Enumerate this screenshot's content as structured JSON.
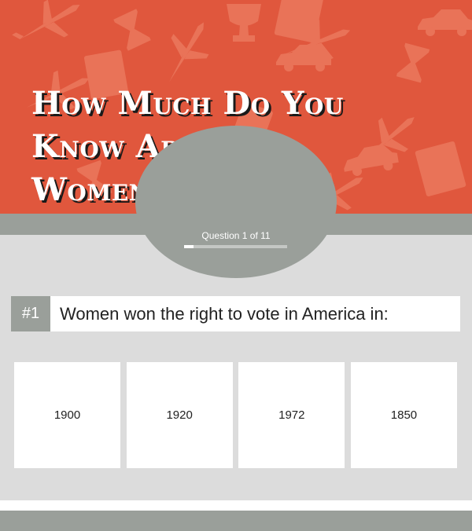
{
  "header": {
    "title_lines": [
      "How Much Do You",
      "Know About",
      "Women's History?"
    ],
    "background_color": "#e0573d",
    "pattern_icons": [
      "airplane-icon",
      "hourglass-icon",
      "book-icon",
      "trophy-icon",
      "car-icon"
    ]
  },
  "progress": {
    "label": "Question 1 of 11",
    "current": 1,
    "total": 11
  },
  "question": {
    "number": "#1",
    "text": "Women won the right to vote in America in:"
  },
  "answers": [
    {
      "label": "1900"
    },
    {
      "label": "1920"
    },
    {
      "label": "1972"
    },
    {
      "label": "1850"
    }
  ],
  "colors": {
    "accent": "#e0573d",
    "band": "#9a9f9a",
    "background": "#dcdcdc"
  }
}
